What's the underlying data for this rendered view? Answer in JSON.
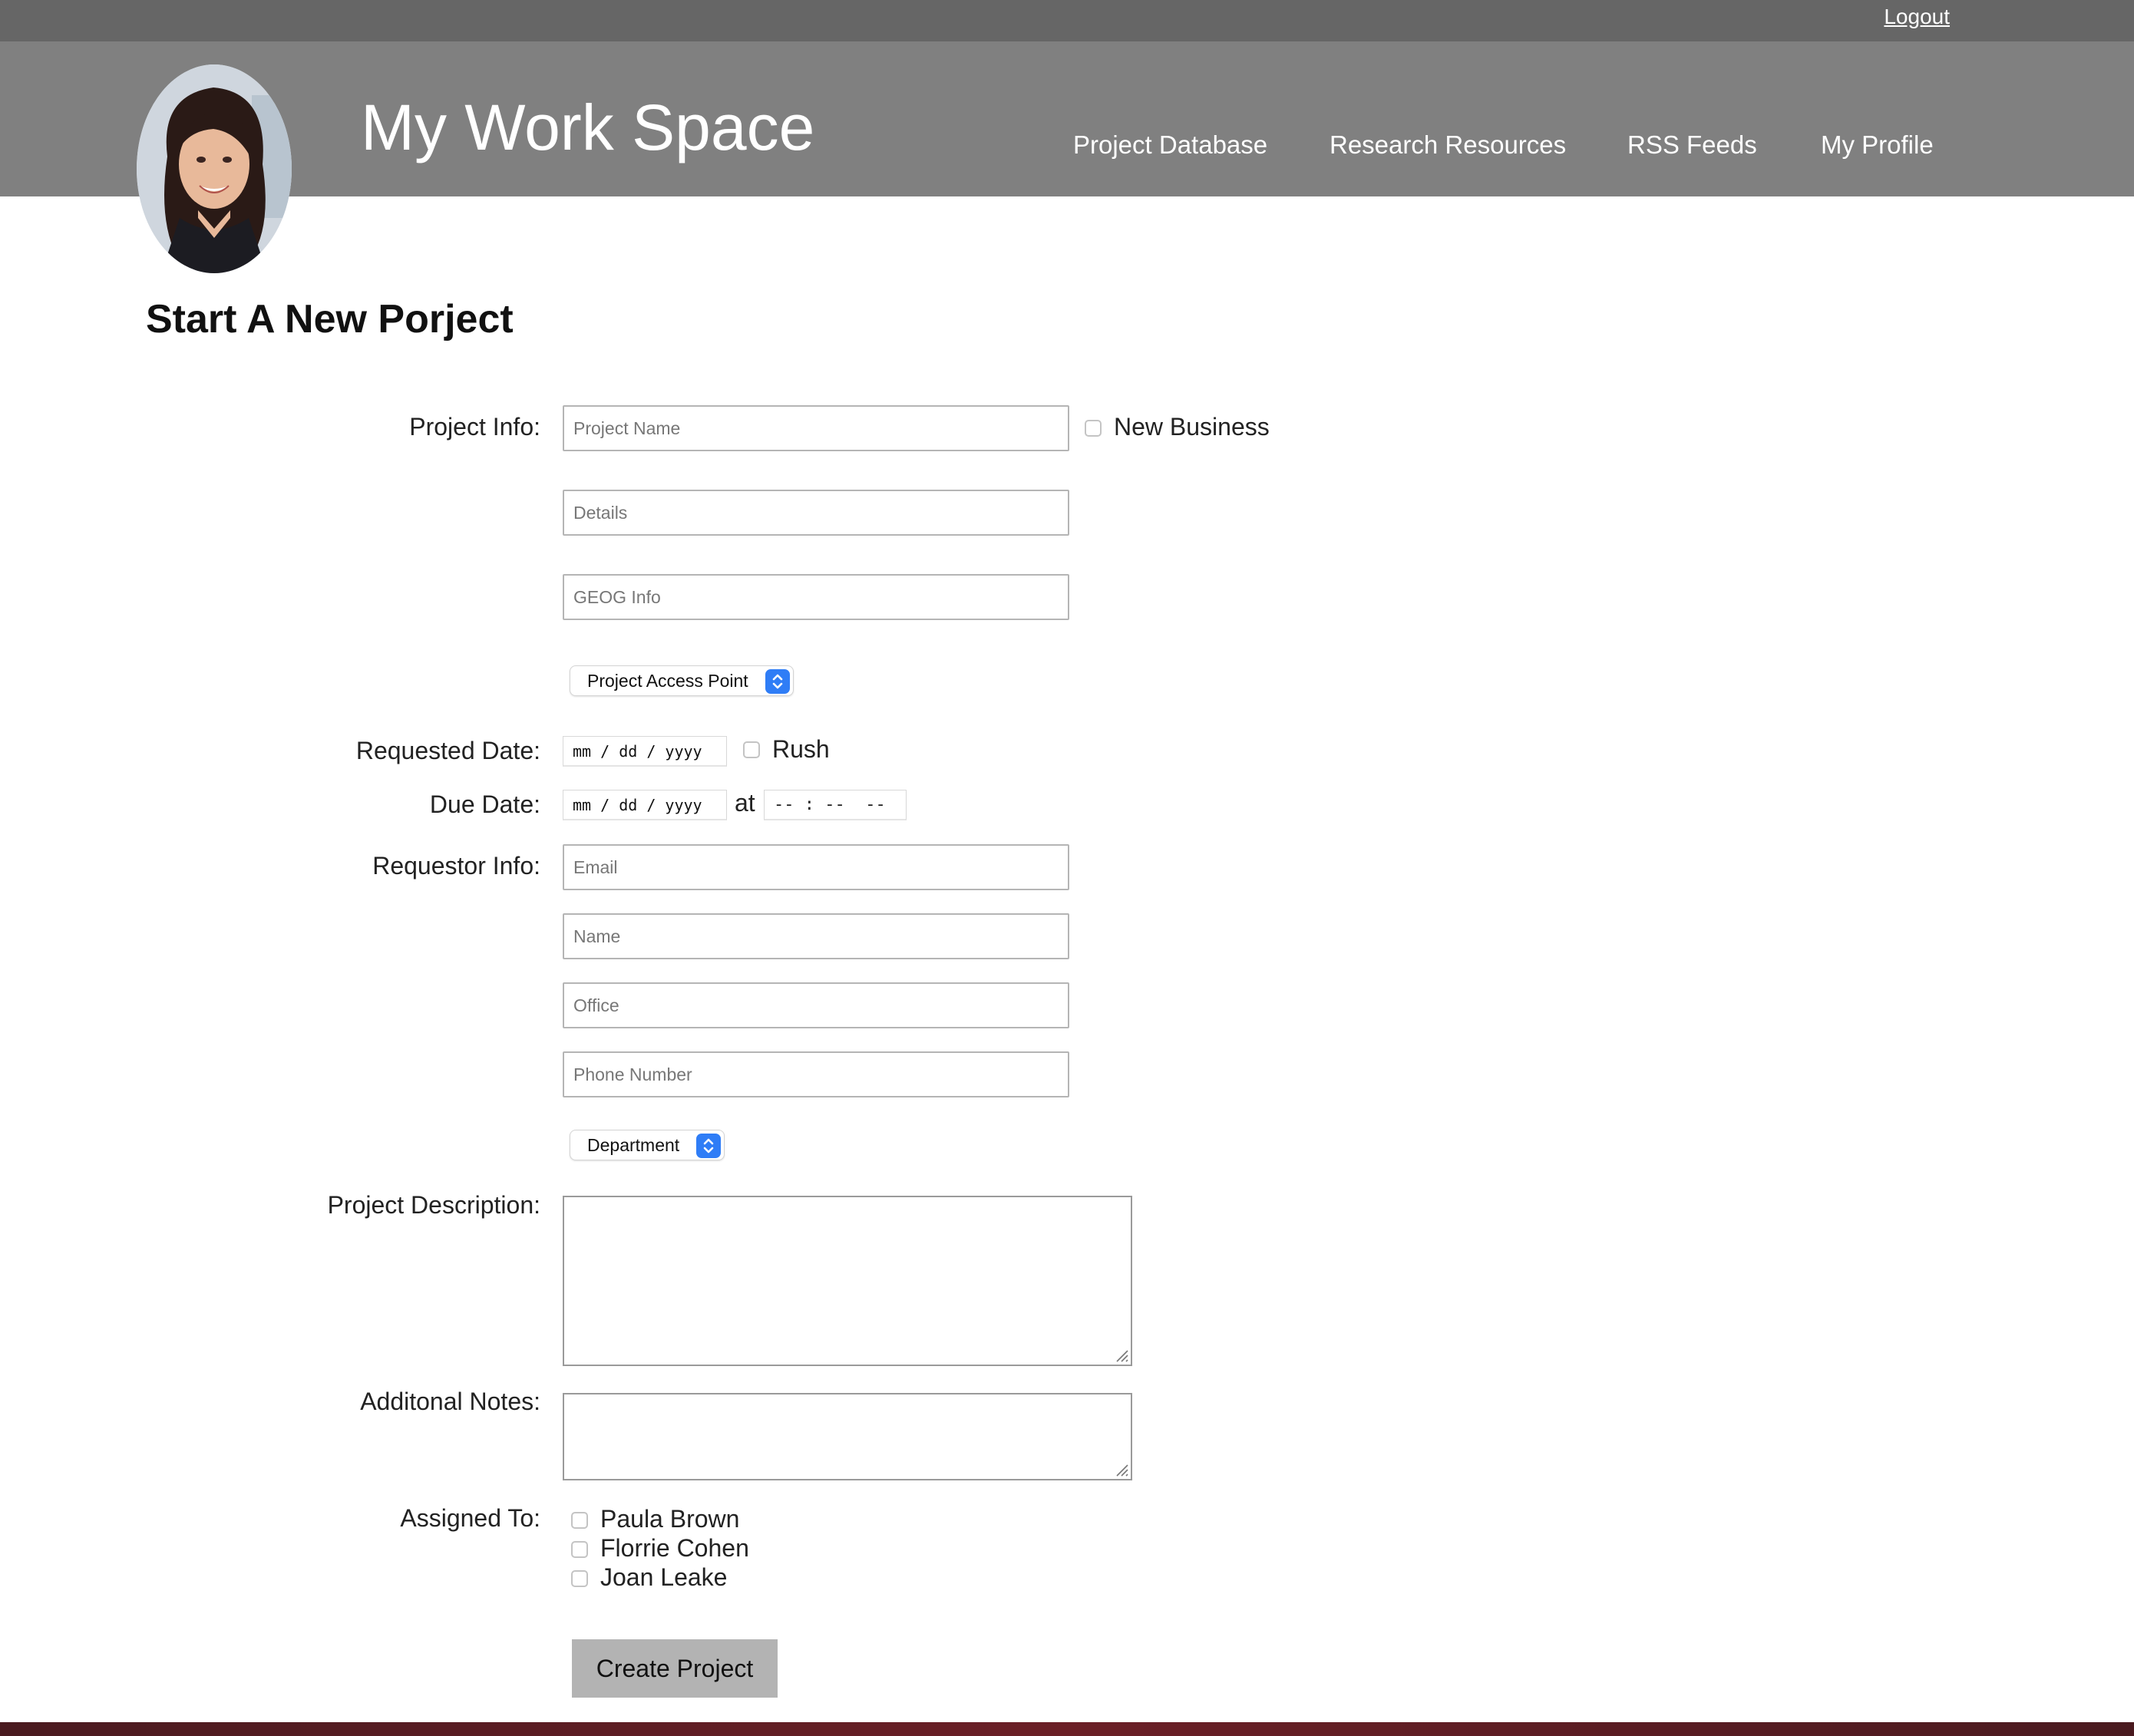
{
  "topbar": {
    "logout_label": "Logout"
  },
  "header": {
    "site_title": "My Work Space",
    "nav": [
      "Project Database",
      "Research Resources",
      "RSS Feeds",
      "My Profile"
    ]
  },
  "page": {
    "heading": "Start A New Porject"
  },
  "form": {
    "project_info_label": "Project Info:",
    "project_name_placeholder": "Project Name",
    "new_business_label": "New Business",
    "details_placeholder": "Details",
    "geog_placeholder": "GEOG Info",
    "access_point_selected": "Project Access Point",
    "requested_date_label": "Requested Date:",
    "date_placeholder": "mm / dd / yyyy",
    "rush_label": "Rush",
    "due_date_label": "Due Date:",
    "at_label": "at",
    "time_placeholder": "-- : --  --",
    "requestor_info_label": "Requestor Info:",
    "email_placeholder": "Email",
    "name_placeholder": "Name",
    "office_placeholder": "Office",
    "phone_placeholder": "Phone Number",
    "department_selected": "Department",
    "project_description_label": "Project Description:",
    "additional_notes_label": "Additonal Notes:",
    "assigned_to_label": "Assigned To:",
    "assignees": [
      "Paula Brown",
      "Florrie Cohen",
      "Joan Leake"
    ],
    "create_button_label": "Create Project"
  },
  "colors": {
    "topbar": "#666666",
    "header": "#808080",
    "button": "#b3b3b3",
    "select_accent": "#2f7df6"
  }
}
